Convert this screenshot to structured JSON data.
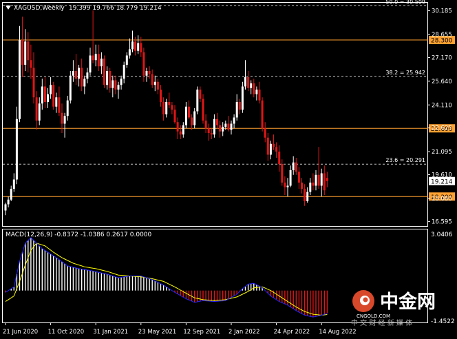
{
  "chart_data": {
    "type": "candlestick",
    "symbol_header": "XAGUSD,Weekly",
    "ohlc_header": "19.399 19.766 18.779 19.214",
    "current_price_label": "19.214",
    "colors": {
      "background": "#000000",
      "frame": "#ffffff",
      "bull": "#ffffff",
      "bear": "#e01616",
      "hline": "#ffa030",
      "macd": "#2323ff",
      "signal": "#ffff00",
      "hist_pos": "#ffffff",
      "hist_neg": "#e01616",
      "fib_line": "#c8c8c8"
    },
    "price_axis": {
      "ylim": [
        16.3,
        30.7
      ],
      "ticks": [
        "30.185",
        "28.655",
        "27.170",
        "25.640",
        "24.110",
        "22.625",
        "21.095",
        "19.610",
        "18.080",
        "16.595"
      ]
    },
    "horizontal_levels": [
      {
        "label": "28.300",
        "value": 28.3
      },
      {
        "label": "22.600",
        "value": 22.6
      },
      {
        "label": "18.200",
        "value": 18.2
      }
    ],
    "fib_levels": [
      {
        "label": "50.0 = 30.509",
        "value": 30.509
      },
      {
        "label": "38.2 = 25.942",
        "value": 25.942
      },
      {
        "label": "23.6 = 20.291",
        "value": 20.291
      }
    ],
    "macd_header": "MACD(12,26,9) -0.8372 -1.0386 0.2617 0.0000",
    "macd_axis": {
      "ylim": [
        -1.75,
        3.35
      ],
      "top_label": "3.0406",
      "bottom_label": "-1.4522"
    },
    "x_labels": [
      "21 Jun 2020",
      "11 Oct 2020",
      "31 Jan 2021",
      "23 May 2021",
      "12 Sep 2021",
      "2 Jan 2022",
      "24 Apr 2022",
      "14 Aug 2022"
    ],
    "x_label_index": [
      0,
      16,
      32,
      48,
      64,
      80,
      96,
      112
    ],
    "candles": [
      [
        17.3,
        17.8,
        17.0,
        17.7
      ],
      [
        17.7,
        18.2,
        17.5,
        18.0
      ],
      [
        18.0,
        18.9,
        17.9,
        18.7
      ],
      [
        18.7,
        19.7,
        18.5,
        19.3
      ],
      [
        19.3,
        24.0,
        19.0,
        23.2
      ],
      [
        23.2,
        29.2,
        23.0,
        28.3
      ],
      [
        28.3,
        29.8,
        25.9,
        26.7
      ],
      [
        26.7,
        29.0,
        26.3,
        28.2
      ],
      [
        28.2,
        28.8,
        26.2,
        27.0
      ],
      [
        27.0,
        28.0,
        25.8,
        26.5
      ],
      [
        26.5,
        27.5,
        24.2,
        24.6
      ],
      [
        24.6,
        25.0,
        22.5,
        23.1
      ],
      [
        23.1,
        24.6,
        22.8,
        24.2
      ],
      [
        24.2,
        25.8,
        23.8,
        25.3
      ],
      [
        25.3,
        25.9,
        23.9,
        24.3
      ],
      [
        24.3,
        25.2,
        23.9,
        24.8
      ],
      [
        24.8,
        25.9,
        24.5,
        25.4
      ],
      [
        25.4,
        25.6,
        23.8,
        24.0
      ],
      [
        24.0,
        24.9,
        23.6,
        24.6
      ],
      [
        24.6,
        25.3,
        23.4,
        23.6
      ],
      [
        23.6,
        24.2,
        22.3,
        22.9
      ],
      [
        22.9,
        23.6,
        22.0,
        23.4
      ],
      [
        23.4,
        24.7,
        23.1,
        24.4
      ],
      [
        24.4,
        26.3,
        24.2,
        26.0
      ],
      [
        26.0,
        27.0,
        25.6,
        26.3
      ],
      [
        26.3,
        27.4,
        25.4,
        25.8
      ],
      [
        25.8,
        26.7,
        25.3,
        26.5
      ],
      [
        26.5,
        27.1,
        25.0,
        25.3
      ],
      [
        25.3,
        26.0,
        24.8,
        25.8
      ],
      [
        25.8,
        26.5,
        25.5,
        26.2
      ],
      [
        26.2,
        27.8,
        26.0,
        27.3
      ],
      [
        27.3,
        30.2,
        26.8,
        27.0
      ],
      [
        27.0,
        28.0,
        26.6,
        27.4
      ],
      [
        27.4,
        28.0,
        26.3,
        26.6
      ],
      [
        26.6,
        27.5,
        26.1,
        27.1
      ],
      [
        27.1,
        27.3,
        25.2,
        25.4
      ],
      [
        25.4,
        26.6,
        25.1,
        26.3
      ],
      [
        26.3,
        26.5,
        24.9,
        25.2
      ],
      [
        25.2,
        26.0,
        24.6,
        25.7
      ],
      [
        25.7,
        26.0,
        24.8,
        25.1
      ],
      [
        25.1,
        25.6,
        24.5,
        25.4
      ],
      [
        25.4,
        26.0,
        25.1,
        25.8
      ],
      [
        25.8,
        26.9,
        25.5,
        26.7
      ],
      [
        26.7,
        27.5,
        26.5,
        27.3
      ],
      [
        27.3,
        28.4,
        27.1,
        27.7
      ],
      [
        27.7,
        28.9,
        27.5,
        28.2
      ],
      [
        28.2,
        28.5,
        27.3,
        27.6
      ],
      [
        27.6,
        28.6,
        27.4,
        28.1
      ],
      [
        28.1,
        28.5,
        27.2,
        27.5
      ],
      [
        27.5,
        27.8,
        25.6,
        26.0
      ],
      [
        26.0,
        26.5,
        25.6,
        26.3
      ],
      [
        26.3,
        26.6,
        25.8,
        26.1
      ],
      [
        26.1,
        26.4,
        25.2,
        25.4
      ],
      [
        25.4,
        26.0,
        25.0,
        25.6
      ],
      [
        25.6,
        25.8,
        24.8,
        25.1
      ],
      [
        25.1,
        25.4,
        24.0,
        24.3
      ],
      [
        24.3,
        24.6,
        23.1,
        23.5
      ],
      [
        23.5,
        24.5,
        23.3,
        24.3
      ],
      [
        24.3,
        24.9,
        23.9,
        24.1
      ],
      [
        24.1,
        24.3,
        23.5,
        23.8
      ],
      [
        23.8,
        24.1,
        22.9,
        23.0
      ],
      [
        23.0,
        23.3,
        21.9,
        22.4
      ],
      [
        22.4,
        22.8,
        21.9,
        22.2
      ],
      [
        22.2,
        23.0,
        22.0,
        22.8
      ],
      [
        22.8,
        24.3,
        22.6,
        24.0
      ],
      [
        24.0,
        24.4,
        23.2,
        23.3
      ],
      [
        23.3,
        23.5,
        22.5,
        22.8
      ],
      [
        22.8,
        23.9,
        22.6,
        23.7
      ],
      [
        23.7,
        25.3,
        23.5,
        25.1
      ],
      [
        25.1,
        25.3,
        24.3,
        24.5
      ],
      [
        24.5,
        24.8,
        22.9,
        23.1
      ],
      [
        23.1,
        23.5,
        22.3,
        22.6
      ],
      [
        22.6,
        22.9,
        21.8,
        22.3
      ],
      [
        22.3,
        22.6,
        21.9,
        22.2
      ],
      [
        22.2,
        23.5,
        22.0,
        23.2
      ],
      [
        23.2,
        23.6,
        22.6,
        22.8
      ],
      [
        22.8,
        23.1,
        22.0,
        22.4
      ],
      [
        22.4,
        23.0,
        22.1,
        22.7
      ],
      [
        22.7,
        23.1,
        22.5,
        22.9
      ],
      [
        22.9,
        23.4,
        22.4,
        22.5
      ],
      [
        22.5,
        23.1,
        22.2,
        22.9
      ],
      [
        22.9,
        23.5,
        22.6,
        23.3
      ],
      [
        23.3,
        24.8,
        23.1,
        24.3
      ],
      [
        24.3,
        24.5,
        23.5,
        23.8
      ],
      [
        23.8,
        25.6,
        23.6,
        25.3
      ],
      [
        25.3,
        27.0,
        25.1,
        25.9
      ],
      [
        25.9,
        26.3,
        25.0,
        25.2
      ],
      [
        25.2,
        25.7,
        24.8,
        25.5
      ],
      [
        25.5,
        25.8,
        24.6,
        24.8
      ],
      [
        24.8,
        25.3,
        24.4,
        25.1
      ],
      [
        25.1,
        25.6,
        24.2,
        24.4
      ],
      [
        24.4,
        24.6,
        22.4,
        22.6
      ],
      [
        22.6,
        23.0,
        21.7,
        22.0
      ],
      [
        22.0,
        22.3,
        20.5,
        20.9
      ],
      [
        20.9,
        21.8,
        20.6,
        21.6
      ],
      [
        21.6,
        22.2,
        21.2,
        21.4
      ],
      [
        21.4,
        21.7,
        20.7,
        21.1
      ],
      [
        21.1,
        21.5,
        19.8,
        20.3
      ],
      [
        20.3,
        20.6,
        18.9,
        19.1
      ],
      [
        19.1,
        19.5,
        18.3,
        18.8
      ],
      [
        18.8,
        19.4,
        18.2,
        18.9
      ],
      [
        18.9,
        20.2,
        18.8,
        19.9
      ],
      [
        19.9,
        20.8,
        19.6,
        20.4
      ],
      [
        20.4,
        20.7,
        19.6,
        19.8
      ],
      [
        19.8,
        20.1,
        18.7,
        19.1
      ],
      [
        19.1,
        19.4,
        18.4,
        18.7
      ],
      [
        18.7,
        19.0,
        17.6,
        17.9
      ],
      [
        17.9,
        18.8,
        17.8,
        18.5
      ],
      [
        18.5,
        19.4,
        18.3,
        19.1
      ],
      [
        19.1,
        19.7,
        18.6,
        18.9
      ],
      [
        18.9,
        19.9,
        18.6,
        19.6
      ],
      [
        19.6,
        21.4,
        18.7,
        18.9
      ],
      [
        18.9,
        20.0,
        18.2,
        19.7
      ],
      [
        19.7,
        20.2,
        18.3,
        18.6
      ],
      [
        19.4,
        19.8,
        18.8,
        19.2
      ]
    ],
    "macd_series": {
      "name": "MACD",
      "points": [
        [
          0,
          -0.1
        ],
        [
          3,
          0.2
        ],
        [
          5,
          1.6
        ],
        [
          7,
          2.6
        ],
        [
          9,
          2.9
        ],
        [
          11,
          2.6
        ],
        [
          13,
          2.3
        ],
        [
          16,
          2.0
        ],
        [
          19,
          1.7
        ],
        [
          22,
          1.35
        ],
        [
          26,
          1.2
        ],
        [
          30,
          1.1
        ],
        [
          33,
          1.0
        ],
        [
          36,
          0.9
        ],
        [
          40,
          0.7
        ],
        [
          44,
          0.8
        ],
        [
          48,
          0.8
        ],
        [
          52,
          0.6
        ],
        [
          56,
          0.3
        ],
        [
          60,
          -0.1
        ],
        [
          64,
          -0.45
        ],
        [
          67,
          -0.65
        ],
        [
          70,
          -0.55
        ],
        [
          74,
          -0.6
        ],
        [
          78,
          -0.55
        ],
        [
          82,
          -0.2
        ],
        [
          84,
          0.1
        ],
        [
          86,
          0.35
        ],
        [
          88,
          0.4
        ],
        [
          91,
          0.15
        ],
        [
          94,
          -0.3
        ],
        [
          97,
          -0.6
        ],
        [
          100,
          -0.8
        ],
        [
          103,
          -1.1
        ],
        [
          106,
          -1.35
        ],
        [
          109,
          -1.45
        ],
        [
          112,
          -1.35
        ],
        [
          115,
          -1.2
        ],
        [
          119,
          -1.05
        ]
      ]
    },
    "signal_series": {
      "name": "Signal",
      "points": [
        [
          0,
          -0.6
        ],
        [
          3,
          -0.3
        ],
        [
          5,
          0.5
        ],
        [
          7,
          1.4
        ],
        [
          9,
          2.2
        ],
        [
          11,
          2.6
        ],
        [
          14,
          2.45
        ],
        [
          17,
          2.1
        ],
        [
          20,
          1.8
        ],
        [
          24,
          1.5
        ],
        [
          28,
          1.3
        ],
        [
          32,
          1.2
        ],
        [
          36,
          1.05
        ],
        [
          40,
          0.85
        ],
        [
          44,
          0.8
        ],
        [
          48,
          0.75
        ],
        [
          52,
          0.65
        ],
        [
          56,
          0.5
        ],
        [
          60,
          0.2
        ],
        [
          64,
          -0.15
        ],
        [
          67,
          -0.4
        ],
        [
          70,
          -0.5
        ],
        [
          74,
          -0.55
        ],
        [
          78,
          -0.5
        ],
        [
          82,
          -0.35
        ],
        [
          86,
          -0.05
        ],
        [
          88,
          0.15
        ],
        [
          91,
          0.2
        ],
        [
          94,
          0.0
        ],
        [
          97,
          -0.3
        ],
        [
          100,
          -0.6
        ],
        [
          103,
          -0.9
        ],
        [
          106,
          -1.15
        ],
        [
          109,
          -1.3
        ],
        [
          112,
          -1.35
        ],
        [
          115,
          -1.3
        ],
        [
          119,
          -1.25
        ]
      ]
    },
    "watermark": {
      "brand": "中金网",
      "url": "CNGOLD.COM",
      "slogan": "中 文 财 经 新 媒 体"
    }
  }
}
